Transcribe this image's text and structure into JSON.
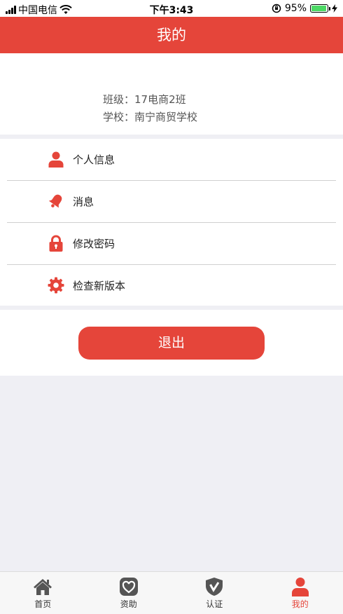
{
  "status_bar": {
    "carrier": "中国电信",
    "time": "下午3:43",
    "battery": "95%",
    "battery_level": 0.95
  },
  "header": {
    "title": "我的"
  },
  "profile": {
    "class_line": "班级：17电商2班",
    "school_line": "学校：南宁商贸学校"
  },
  "menu": {
    "items": [
      {
        "label": "个人信息",
        "icon": "person-icon"
      },
      {
        "label": "消息",
        "icon": "bell-icon"
      },
      {
        "label": "修改密码",
        "icon": "lock-icon"
      },
      {
        "label": "检查新版本",
        "icon": "gear-icon"
      }
    ]
  },
  "logout": {
    "label": "退出"
  },
  "tab_bar": {
    "items": [
      {
        "label": "首页",
        "icon": "home-icon",
        "active": false
      },
      {
        "label": "资助",
        "icon": "heart-icon",
        "active": false
      },
      {
        "label": "认证",
        "icon": "shield-check-icon",
        "active": false
      },
      {
        "label": "我的",
        "icon": "person-icon",
        "active": true
      }
    ]
  },
  "colors": {
    "accent": "#e5453a",
    "tab_inactive": "#555555",
    "background": "#efeff4"
  }
}
